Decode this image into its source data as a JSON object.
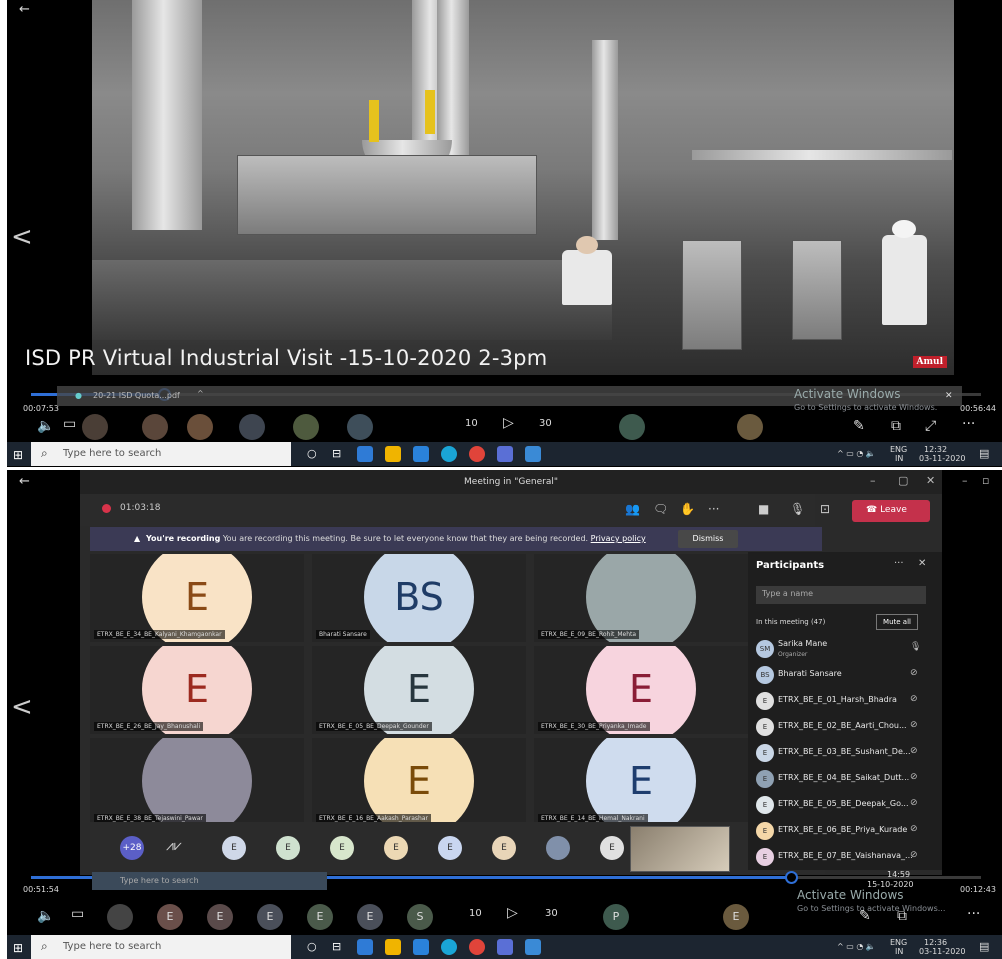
{
  "shot1": {
    "back_glyph": "←",
    "prev_glyph": "<",
    "title": "ISD PR Virtual Industrial Visit -15-10-2020 2-3pm",
    "brand": "Amul",
    "elapsed": "00:07:53",
    "remaining": "00:56:44",
    "progress": 0.14,
    "download_file": "20-21 ISD Quota...pdf",
    "activate_title": "Activate Windows",
    "activate_sub": "Go to Settings to activate Windows.",
    "controls": {
      "back10": "10",
      "fwd30": "30",
      "play": "▷",
      "more": "···"
    }
  },
  "shot2": {
    "back_glyph": "←",
    "prev_glyph": "<",
    "window_title": "Meeting in \"General\"",
    "rec_time": "01:03:18",
    "leave_label": "Leave",
    "banner_bold": "You're recording",
    "banner_text": "You are recording this meeting. Be sure to let everyone know that they are being recorded.",
    "banner_link": "Privacy policy",
    "dismiss_label": "Dismiss",
    "tiles": [
      {
        "initials": "E",
        "name": "ETRX_BE_E_34_BE_Kalyani_Khamgaonkar",
        "bg": "#f9e3c6",
        "fg": "#8a4a16"
      },
      {
        "initials": "BS",
        "name": "Bharati Sansare",
        "bg": "#c8d7e8",
        "fg": "#1f3c66"
      },
      {
        "initials": "",
        "name": "ETRX_BE_E_09_BE_Rohit_Mehta",
        "bg": "#9aa7a8",
        "fg": "#333"
      },
      {
        "initials": "E",
        "name": "ETRX_BE_E_26_BE_Jay_Bhanushali",
        "bg": "#f6d6d0",
        "fg": "#9c2a1f"
      },
      {
        "initials": "E",
        "name": "ETRX_BE_E_05_BE_Deepak_Gounder",
        "bg": "#d3dde2",
        "fg": "#27363e"
      },
      {
        "initials": "E",
        "name": "ETRX_BE_E_30_BE_Priyanka_Imade",
        "bg": "#f7d4de",
        "fg": "#8a1d36"
      },
      {
        "initials": "",
        "name": "ETRX_BE_E_38_BE_Tejaswini_Pawar",
        "bg": "#8d8a9a",
        "fg": "#333"
      },
      {
        "initials": "E",
        "name": "ETRX_BE_E_16_BE_Aakash_Parashar",
        "bg": "#f6e0b6",
        "fg": "#7a4b09"
      },
      {
        "initials": "E",
        "name": "ETRX_BE_E_14_BE_Hemal_Nakrani",
        "bg": "#cfdcee",
        "fg": "#1e3d6e"
      }
    ],
    "strip_more": "+28",
    "panel_title": "Participants",
    "search_placeholder": "Type a name",
    "in_meeting": "In this meeting (47)",
    "mute_all": "Mute all",
    "participants": [
      {
        "initials": "SM",
        "name": "Sarika Mane",
        "role": "Organizer",
        "bg": "#b5c8e0"
      },
      {
        "initials": "BS",
        "name": "Bharati Sansare",
        "role": "",
        "bg": "#b5c8e0"
      },
      {
        "initials": "E",
        "name": "ETRX_BE_E_01_Harsh_Bhadra",
        "role": "",
        "bg": "#e0e0e0"
      },
      {
        "initials": "E",
        "name": "ETRX_BE_E_02_BE_Aarti_Chou...",
        "role": "",
        "bg": "#e0e0e0"
      },
      {
        "initials": "E",
        "name": "ETRX_BE_E_03_BE_Sushant_De...",
        "role": "",
        "bg": "#c9d6e6"
      },
      {
        "initials": "E",
        "name": "ETRX_BE_E_04_BE_Saikat_Dutt...",
        "role": "",
        "bg": "#8fa1b3"
      },
      {
        "initials": "E",
        "name": "ETRX_BE_E_05_BE_Deepak_Go...",
        "role": "",
        "bg": "#dfe6ea"
      },
      {
        "initials": "E",
        "name": "ETRX_BE_E_06_BE_Priya_Kurade",
        "role": "",
        "bg": "#f4d7a8"
      },
      {
        "initials": "E",
        "name": "ETRX_BE_E_07_BE_Vaishanava_...",
        "role": "",
        "bg": "#e7cfe2"
      }
    ],
    "elapsed": "00:51:54",
    "remaining": "00:12:43",
    "progress": 0.8,
    "activate_title": "Activate Windows",
    "activate_sub": "Go to Settings to activate Windows...",
    "inner_search": "Type here to search",
    "inner_time": "14:59",
    "inner_date": "15-10-2020"
  },
  "taskbar": {
    "search_placeholder": "Type here to search",
    "lang": "ENG",
    "region": "IN",
    "time1": "12:32",
    "date1": "03-11-2020",
    "time2": "12:36",
    "date2": "03-11-2020"
  },
  "colors": {
    "accent": "#2f6fd6",
    "leave": "#c4314b",
    "taskbar": "#1c2530"
  }
}
